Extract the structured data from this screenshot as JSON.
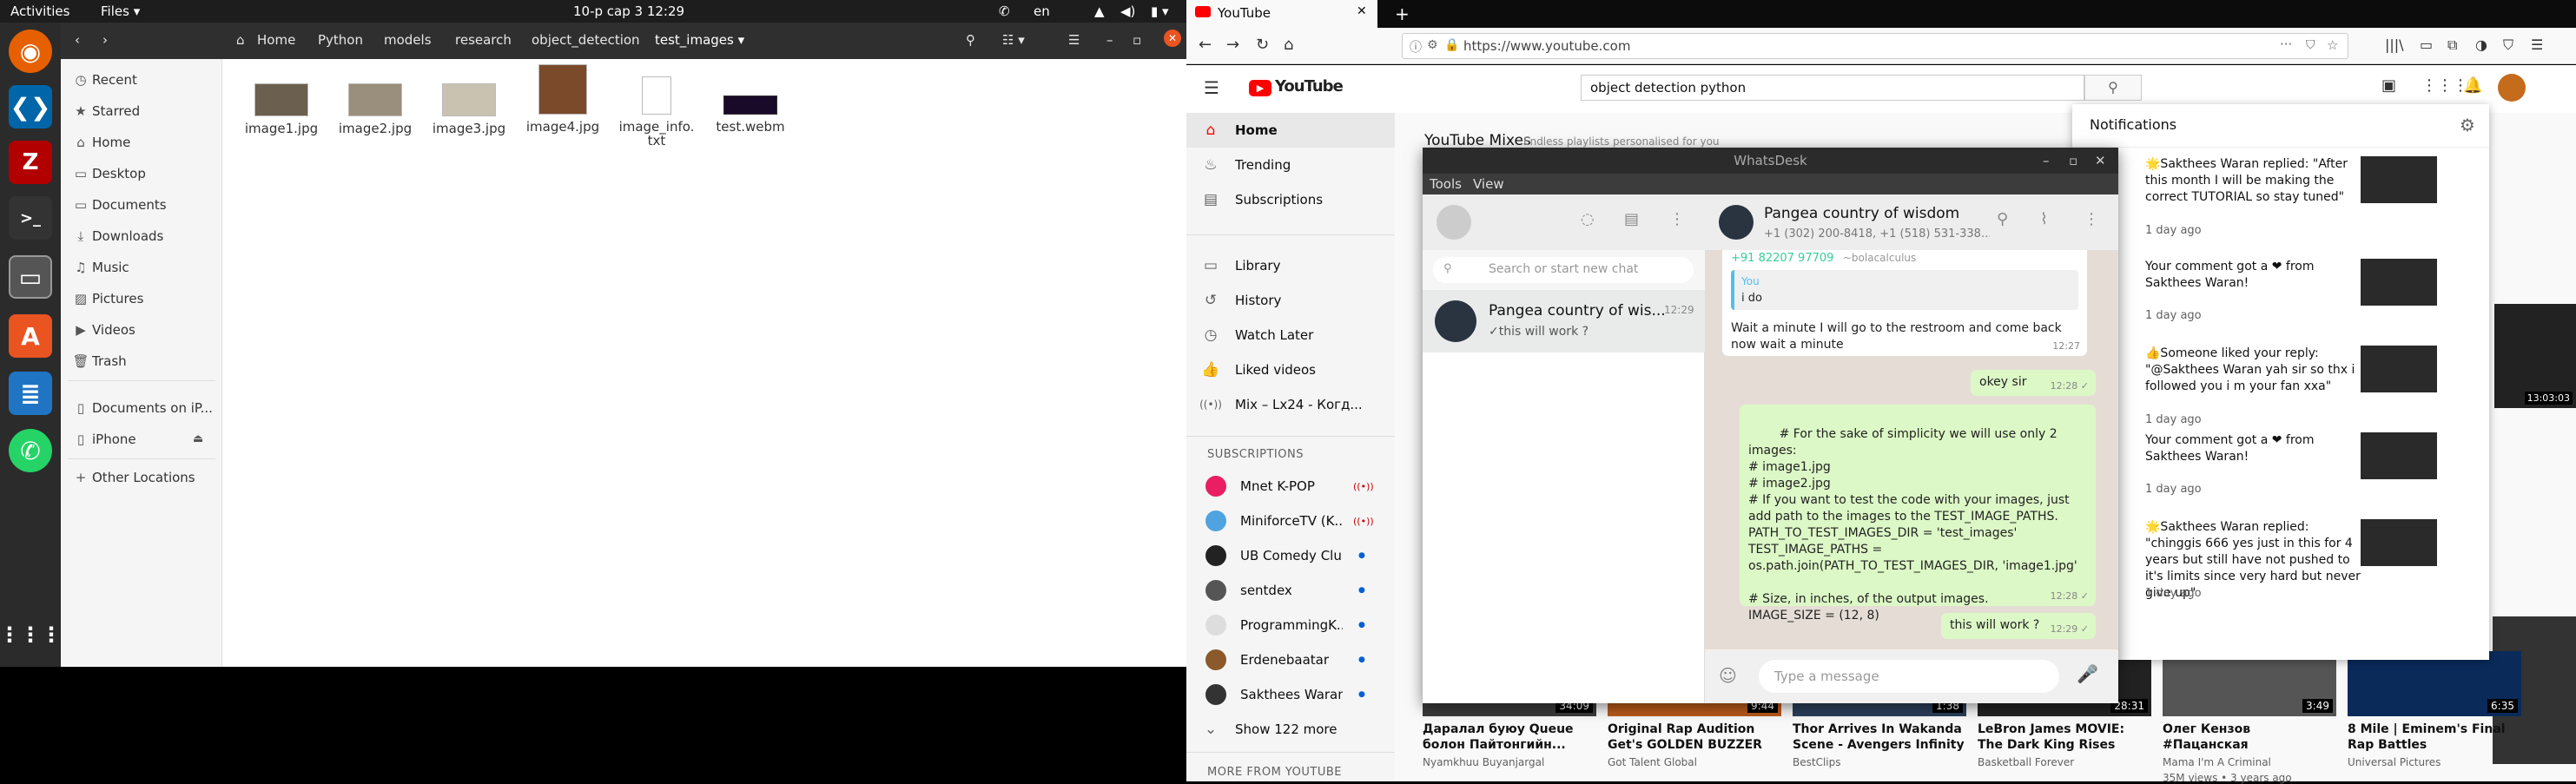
{
  "topbar": {
    "activities": "Activities",
    "app": "Files",
    "clock": "10-р сар 3  12:29",
    "lang": "en"
  },
  "files": {
    "path": [
      "Home",
      "Python",
      "models",
      "research",
      "object_detection",
      "test_images"
    ],
    "sidebar": [
      {
        "label": "Recent",
        "icon": "clock-icon"
      },
      {
        "label": "Starred",
        "icon": "star-icon"
      },
      {
        "label": "Home",
        "icon": "home-icon"
      },
      {
        "label": "Desktop",
        "icon": "folder-icon"
      },
      {
        "label": "Documents",
        "icon": "folder-icon"
      },
      {
        "label": "Downloads",
        "icon": "download-icon"
      },
      {
        "label": "Music",
        "icon": "music-icon"
      },
      {
        "label": "Pictures",
        "icon": "pictures-icon"
      },
      {
        "label": "Videos",
        "icon": "video-icon"
      },
      {
        "label": "Trash",
        "icon": "trash-icon"
      },
      {
        "label": "Documents on iP...",
        "icon": "phone-icon"
      },
      {
        "label": "iPhone",
        "icon": "phone-icon"
      },
      {
        "label": "Other Locations",
        "icon": "plus-icon"
      }
    ],
    "items": [
      {
        "name": "image1.jpg"
      },
      {
        "name": "image2.jpg"
      },
      {
        "name": "image3.jpg"
      },
      {
        "name": "image4.jpg"
      },
      {
        "name": "image_info.\ntxt"
      },
      {
        "name": "test.webm"
      }
    ]
  },
  "browser": {
    "tab_title": "YouTube",
    "url": "https://www.youtube.com"
  },
  "youtube": {
    "logo": "YouTube",
    "search": "object detection python",
    "nav": [
      {
        "label": "Home",
        "icon": "home-icon"
      },
      {
        "label": "Trending",
        "icon": "fire-icon"
      },
      {
        "label": "Subscriptions",
        "icon": "subscriptions-icon"
      },
      {
        "label": "Library",
        "icon": "folder-icon"
      },
      {
        "label": "History",
        "icon": "history-icon"
      },
      {
        "label": "Watch Later",
        "icon": "clock-icon"
      },
      {
        "label": "Liked videos",
        "icon": "thumb-up-icon"
      },
      {
        "label": "Mix – Lx24 - Когд...",
        "icon": "mix-icon"
      }
    ],
    "subs_header": "SUBSCRIPTIONS",
    "subs": [
      {
        "name": "Mnet K-POP",
        "color": "#e91e63",
        "live": true
      },
      {
        "name": "MiniforceTV (K...",
        "color": "#4fa3e0",
        "live": true
      },
      {
        "name": "UB Comedy Club",
        "color": "#222222",
        "live": false
      },
      {
        "name": "sentdex",
        "color": "#555555",
        "live": false
      },
      {
        "name": "ProgrammingK...",
        "color": "#dddddd",
        "live": false
      },
      {
        "name": "Erdenebaatar",
        "color": "#8b5a2b",
        "live": false
      },
      {
        "name": "Sakthees Waran",
        "color": "#333333",
        "live": false
      }
    ],
    "show_more": "Show 122 more",
    "more_header": "MORE FROM YOUTUBE",
    "mixes_title": "YouTube Mixes",
    "mixes_sub": "Endless playlists personalised for you",
    "videos": [
      {
        "title": "Даралал буюу Queue болон Пайтонгийн...",
        "channel": "Nyamkhuu Buyanjargal",
        "duration": "34:09"
      },
      {
        "title": "Original Rap Audition Get's GOLDEN BUZZER On...",
        "channel": "Got Talent Global",
        "duration": "9:44"
      },
      {
        "title": "Thor Arrives In Wakanda Scene - Avengers Infinity W...",
        "channel": "BestClips",
        "duration": "1:38"
      },
      {
        "title": "LeBron James MOVIE: The Dark King Rises",
        "channel": "Basketball Forever",
        "duration": "28:31"
      },
      {
        "title": "Олег Кензов #Пацанская",
        "channel": "Mama I'm A Criminal",
        "duration": "3:49"
      },
      {
        "title": "8 Mile | Eminem's Final Rap Battles",
        "channel": "Universal Pictures",
        "duration": "6:35"
      }
    ],
    "video_meta": [
      "",
      "",
      "",
      "",
      "35M views • 3 years ago",
      ""
    ],
    "notifications_title": "Notifications",
    "notifications": [
      {
        "text": "🌟Sakthees Waran replied: \"After this month I will be making the correct TUTORIAL so stay tuned\"",
        "time": "1 day ago"
      },
      {
        "text": "Your comment got a ❤ from Sakthees Waran!",
        "time": "1 day ago"
      },
      {
        "text": "👍Someone liked your reply: \"@Sakthees Waran yah sir so thx i followed you i m your fan xxa\"",
        "time": "1 day ago"
      },
      {
        "text": "Your comment got a ❤ from Sakthees Waran!",
        "time": "1 day ago"
      },
      {
        "text": "🌟Sakthees Waran replied: \"chinggis 666 yes just in this for 4 years but still have not pushed to it's limits since very hard but never give up\"",
        "time": "1 day ago"
      }
    ],
    "right_dur": "13:03:03"
  },
  "whatsdesk": {
    "title": "WhatsDesk",
    "menu": [
      "Tools",
      "View"
    ],
    "search_placeholder": "Search or start new chat",
    "chat_name": "Pangea country of wisdom",
    "chat_members": "+1 (302) 200-8418, +1 (518) 531-338...",
    "list_item": {
      "name": "Pangea country of wis...",
      "time": "12:29",
      "preview": "✓this will work ?"
    },
    "quoted_sender": "+91 82207 97709",
    "quoted_handle": "~bolacalculus",
    "reply_you": "You",
    "reply_text": "i do",
    "msg1": "Wait a minute I will go to the restroom and come back now wait a minute",
    "msg1_time": "12:27",
    "msg2": "okey sir",
    "msg2_time": "12:28 ✓",
    "msg3": "# For the sake of simplicity we will use only 2 images:\n# image1.jpg\n# image2.jpg\n# If you want to test the code with your images, just add path to the images to the TEST_IMAGE_PATHS.\nPATH_TO_TEST_IMAGES_DIR = 'test_images'\nTEST_IMAGE_PATHS =\nos.path.join(PATH_TO_TEST_IMAGES_DIR, 'image1.jpg'\n\n# Size, in inches, of the output images.\nIMAGE_SIZE = (12, 8)",
    "msg3_time": "12:28 ✓",
    "msg4": "this will work ?",
    "msg4_time": "12:29 ✓",
    "input_placeholder": "Type a message"
  }
}
